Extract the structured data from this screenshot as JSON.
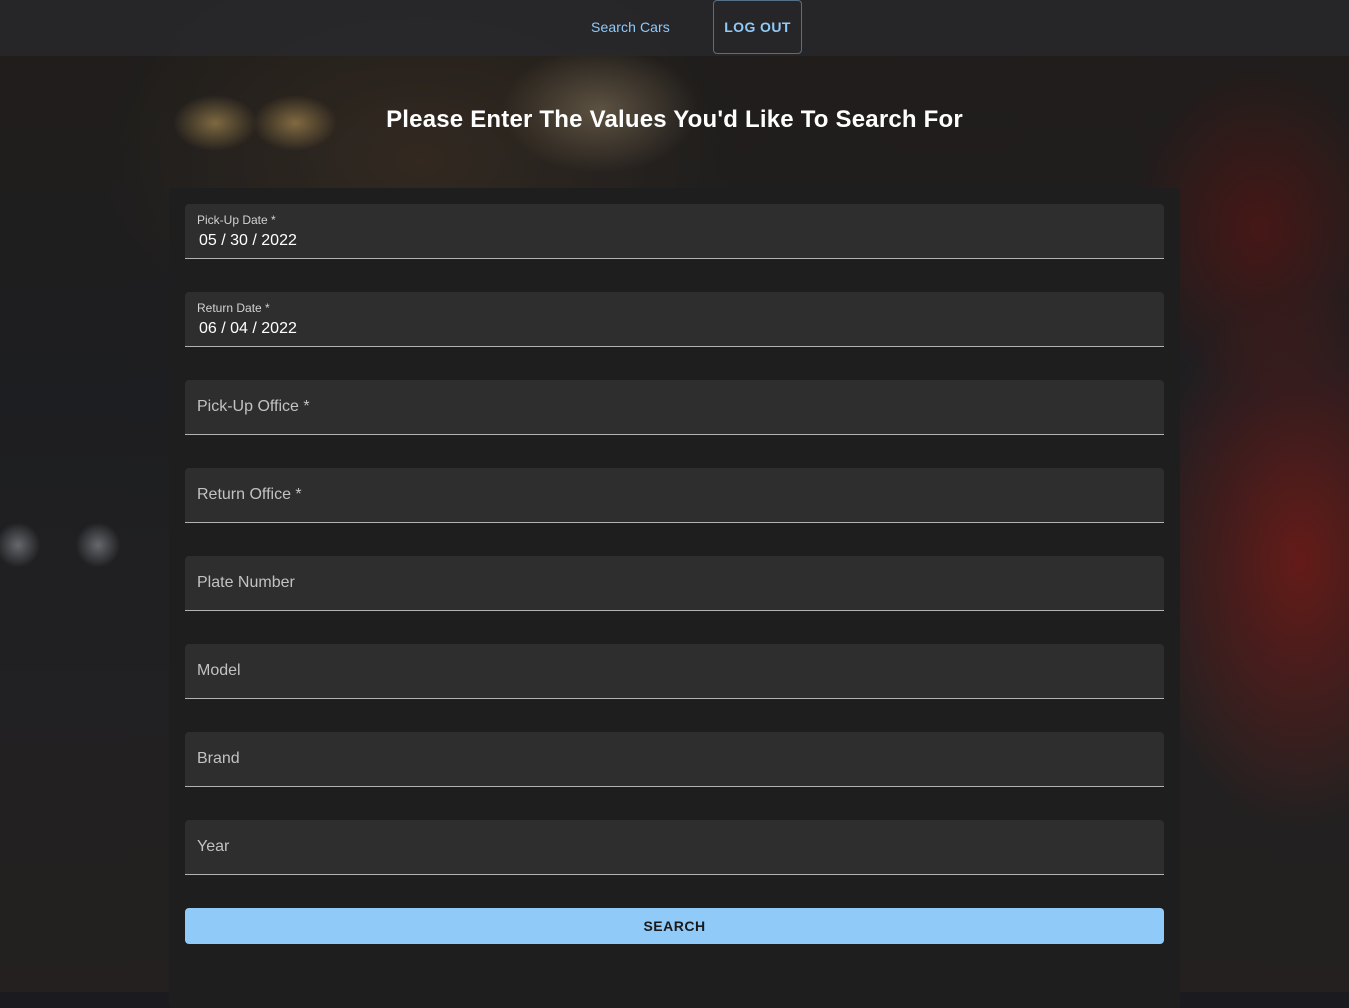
{
  "nav": {
    "search_cars": "Search Cars",
    "logout": "LOG OUT"
  },
  "heading": "Please Enter The Values You'd Like To Search For",
  "form": {
    "pickup_date": {
      "label": "Pick-Up Date *",
      "value": "05 / 30 / 2022"
    },
    "return_date": {
      "label": "Return Date *",
      "value": "06 / 04 / 2022"
    },
    "pickup_office": {
      "label": "Pick-Up Office *"
    },
    "return_office": {
      "label": "Return Office *"
    },
    "plate_number": {
      "label": "Plate Number"
    },
    "model": {
      "label": "Model"
    },
    "brand": {
      "label": "Brand"
    },
    "year": {
      "label": "Year"
    },
    "submit_label": "SEARCH"
  },
  "colors": {
    "accent": "#90caf9",
    "card_bg": "#1e1e1e",
    "field_bg": "#2e2e2e"
  }
}
